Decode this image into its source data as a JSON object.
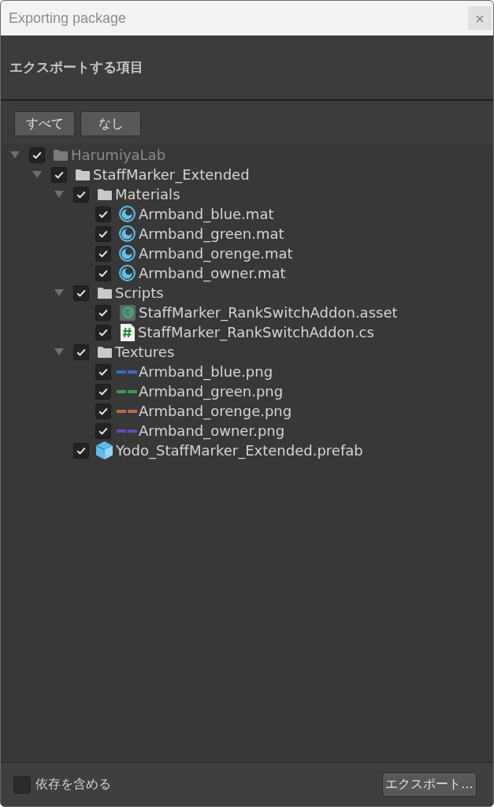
{
  "window": {
    "title": "Exporting package",
    "close_label": "×"
  },
  "header": {
    "title": "エクスポートする項目"
  },
  "toolbar": {
    "buttons": [
      "すべて",
      "なし"
    ]
  },
  "tree": [
    {
      "name": "HarumiyaLab",
      "kind": "folder",
      "checked": true,
      "expanded": true,
      "disabled": true,
      "children": [
        {
          "name": "StaffMarker_Extended",
          "kind": "folder",
          "checked": true,
          "expanded": true,
          "disabled": false,
          "children": [
            {
              "name": "Materials",
              "kind": "folder",
              "checked": true,
              "expanded": true,
              "disabled": false,
              "children": [
                {
                  "name": "Armband_blue.mat",
                  "kind": "material",
                  "checked": true,
                  "disabled": false
                },
                {
                  "name": "Armband_green.mat",
                  "kind": "material",
                  "checked": true,
                  "disabled": false
                },
                {
                  "name": "Armband_orenge.mat",
                  "kind": "material",
                  "checked": true,
                  "disabled": false
                },
                {
                  "name": "Armband_owner.mat",
                  "kind": "material",
                  "checked": true,
                  "disabled": false
                }
              ]
            },
            {
              "name": "Scripts",
              "kind": "folder",
              "checked": true,
              "expanded": true,
              "disabled": false,
              "children": [
                {
                  "name": "StaffMarker_RankSwitchAddon.asset",
                  "kind": "asset",
                  "checked": true,
                  "disabled": false
                },
                {
                  "name": "StaffMarker_RankSwitchAddon.cs",
                  "kind": "script",
                  "checked": true,
                  "disabled": false
                }
              ]
            },
            {
              "name": "Textures",
              "kind": "folder",
              "checked": true,
              "expanded": true,
              "disabled": false,
              "children": [
                {
                  "name": "Armband_blue.png",
                  "kind": "texture",
                  "checked": true,
                  "disabled": false,
                  "color": "#3a6cc2"
                },
                {
                  "name": "Armband_green.png",
                  "kind": "texture",
                  "checked": true,
                  "disabled": false,
                  "color": "#3a9a5a"
                },
                {
                  "name": "Armband_orenge.png",
                  "kind": "texture",
                  "checked": true,
                  "disabled": false,
                  "color": "#b86a4a"
                },
                {
                  "name": "Armband_owner.png",
                  "kind": "texture",
                  "checked": true,
                  "disabled": false,
                  "color": "#6a48b4"
                }
              ]
            },
            {
              "name": "Yodo_StaffMarker_Extended.prefab",
              "kind": "prefab",
              "checked": true,
              "disabled": false
            }
          ]
        }
      ]
    }
  ],
  "footer": {
    "include_dependencies": {
      "label": "依存を含める",
      "checked": false
    },
    "export_button": "エクスポート..."
  }
}
